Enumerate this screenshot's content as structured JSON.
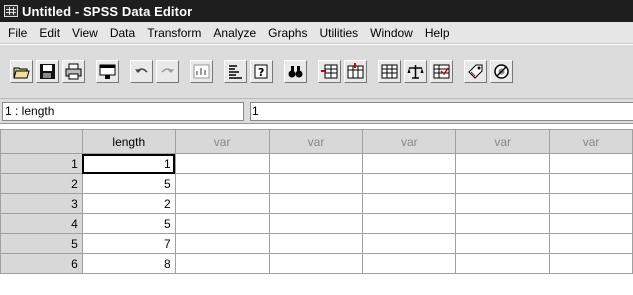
{
  "window": {
    "title": "Untitled - SPSS Data Editor"
  },
  "menubar": {
    "items": [
      "File",
      "Edit",
      "View",
      "Data",
      "Transform",
      "Analyze",
      "Graphs",
      "Utilities",
      "Window",
      "Help"
    ]
  },
  "toolbar": {
    "buttons": [
      "open-file-icon",
      "save-icon",
      "print-icon",
      "dialog-recall-icon",
      "undo-icon",
      "redo-icon",
      "goto-chart-icon",
      "goto-case-icon",
      "variables-icon",
      "find-icon",
      "insert-case-icon",
      "insert-variable-icon",
      "split-file-icon",
      "weight-cases-icon",
      "select-cases-icon",
      "value-labels-icon",
      "use-sets-icon"
    ]
  },
  "cell_editor": {
    "cell_name": "1 : length",
    "cell_value": "1"
  },
  "grid": {
    "columns": [
      "length",
      "var",
      "var",
      "var",
      "var",
      "var"
    ],
    "rows": [
      {
        "num": "1",
        "length": "1"
      },
      {
        "num": "2",
        "length": "5"
      },
      {
        "num": "3",
        "length": "2"
      },
      {
        "num": "4",
        "length": "5"
      },
      {
        "num": "5",
        "length": "7"
      },
      {
        "num": "6",
        "length": "8"
      }
    ]
  }
}
